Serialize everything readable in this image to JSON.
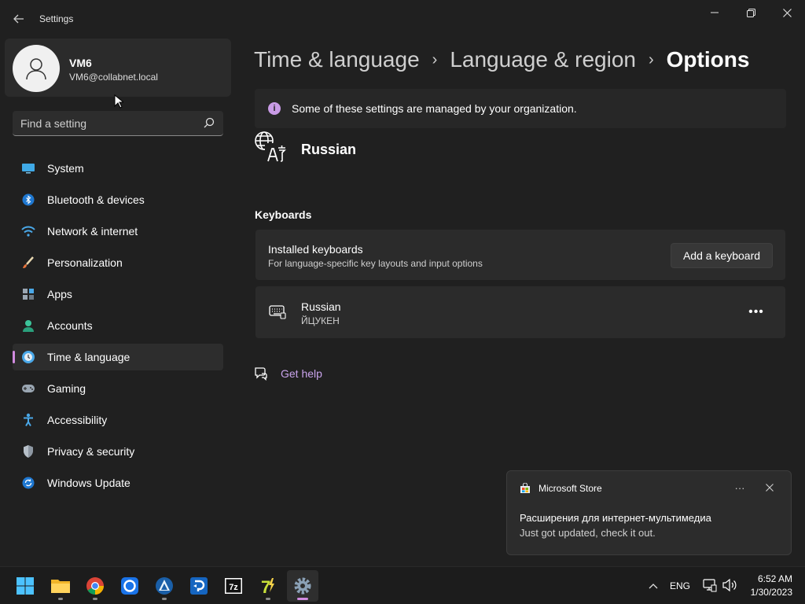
{
  "window": {
    "title": "Settings",
    "back_icon": "back-arrow-icon",
    "controls": {
      "minimize": "minimize-icon",
      "maximize": "restore-icon",
      "close": "close-icon"
    }
  },
  "profile": {
    "name": "VM6",
    "email": "VM6@collabnet.local",
    "avatar_icon": "person-icon"
  },
  "search": {
    "placeholder": "Find a setting",
    "icon": "search-icon"
  },
  "sidebar": {
    "selected_index": 6,
    "accent_color": "#d18be0",
    "items": [
      {
        "label": "System",
        "icon": "monitor-icon"
      },
      {
        "label": "Bluetooth & devices",
        "icon": "bluetooth-icon"
      },
      {
        "label": "Network & internet",
        "icon": "wifi-icon"
      },
      {
        "label": "Personalization",
        "icon": "brush-icon"
      },
      {
        "label": "Apps",
        "icon": "apps-icon"
      },
      {
        "label": "Accounts",
        "icon": "account-icon"
      },
      {
        "label": "Time & language",
        "icon": "clock-globe-icon"
      },
      {
        "label": "Gaming",
        "icon": "gamepad-icon"
      },
      {
        "label": "Accessibility",
        "icon": "accessibility-icon"
      },
      {
        "label": "Privacy & security",
        "icon": "shield-icon"
      },
      {
        "label": "Windows Update",
        "icon": "update-icon"
      }
    ]
  },
  "breadcrumb": {
    "items": [
      "Time & language",
      "Language & region"
    ],
    "current": "Options",
    "separator_icon": "chevron-right-icon"
  },
  "info_bar": {
    "text": "Some of these settings are managed by your organization.",
    "icon": "info-icon",
    "icon_color": "#c99be6"
  },
  "language": {
    "name": "Russian",
    "icon": "language-icon"
  },
  "keyboards": {
    "section_title": "Keyboards",
    "installed_title": "Installed keyboards",
    "installed_subtitle": "For language-specific key layouts and input options",
    "add_button": "Add a keyboard",
    "items": [
      {
        "name": "Russian",
        "layout": "ЙЦУКЕН",
        "icon": "keyboard-icon",
        "more_icon": "more-horizontal-icon"
      }
    ]
  },
  "help": {
    "label": "Get help",
    "icon": "help-chat-icon",
    "color": "#c9a3ec"
  },
  "toast": {
    "app_name": "Microsoft Store",
    "app_icon": "store-icon",
    "title": "Расширения для интернет-мультимедиа",
    "body": "Just got updated, check it out.",
    "more_icon": "more-horizontal-icon",
    "close_icon": "close-icon"
  },
  "taskbar": {
    "apps": [
      {
        "name": "start-icon"
      },
      {
        "name": "file-explorer-icon"
      },
      {
        "name": "chrome-icon"
      },
      {
        "name": "circle-app-icon"
      },
      {
        "name": "triangle-app-icon"
      },
      {
        "name": "remote-desktop-icon"
      },
      {
        "name": "7zip-icon"
      },
      {
        "name": "7-lightning-icon"
      },
      {
        "name": "settings-gear-icon",
        "active": true
      }
    ],
    "tray": {
      "chevron": "chevron-up-icon",
      "language": "ENG",
      "network_icon": "network-icon",
      "volume_icon": "volume-icon",
      "time": "6:52 AM",
      "date": "1/30/2023"
    }
  }
}
